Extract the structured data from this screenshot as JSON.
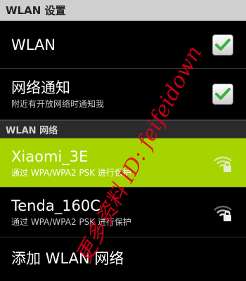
{
  "header": {
    "title": "WLAN 设置"
  },
  "wlan_toggle": {
    "label": "WLAN",
    "checked": true
  },
  "network_notify": {
    "label": "网络通知",
    "summary": "附近有开放网络时通知我",
    "checked": true
  },
  "section": {
    "title": "WLAN 网络"
  },
  "networks": [
    {
      "ssid": "Xiaomi_3E",
      "security": "通过 WPA/WPA2 PSK 进行保护",
      "icon": "wifi-lock-icon",
      "selected": true
    },
    {
      "ssid": "Tenda_160C",
      "security": "通过 WPA/WPA2 PSK 进行保护",
      "icon": "wifi-lock-icon",
      "selected": false
    }
  ],
  "add_network": {
    "label": "添加 WLAN 网络"
  },
  "watermark": {
    "text": "更多资料 ID: feifeidown"
  },
  "colors": {
    "accent_green": "#a6d400",
    "check_green": "#3bb143",
    "watermark_red": "#e8001c"
  }
}
